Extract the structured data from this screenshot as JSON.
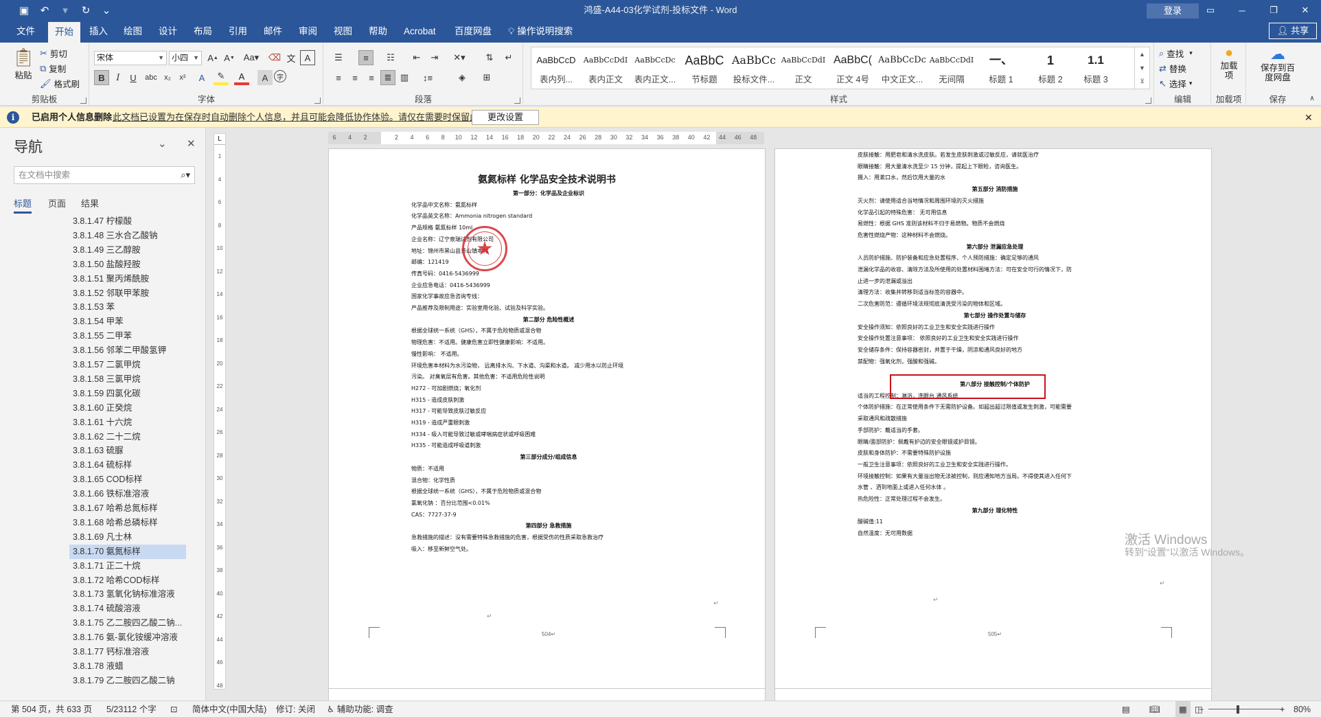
{
  "titlebar": {
    "title": "鸿盛-A44-03化学试剂-投标文件  -  Word",
    "login": "登录",
    "save_icon": "save-icon",
    "undo_icon": "undo-icon",
    "redo_icon": "redo-icon",
    "customize_icon": "customize-icon"
  },
  "menu": {
    "items": [
      "文件",
      "开始",
      "插入",
      "绘图",
      "设计",
      "布局",
      "引用",
      "邮件",
      "审阅",
      "视图",
      "帮助",
      "Acrobat",
      "百度网盘"
    ],
    "active": "开始",
    "tell_me": "操作说明搜索",
    "share": "共享"
  },
  "ribbon": {
    "clipboard": {
      "paste": "粘贴",
      "cut": "剪切",
      "copy": "复制",
      "format_painter": "格式刷",
      "label": "剪贴板"
    },
    "font": {
      "name": "宋体",
      "size": "小四",
      "label": "字体"
    },
    "paragraph": {
      "label": "段落"
    },
    "styles": {
      "label": "样式",
      "items": [
        {
          "preview": "AaBbCcD",
          "name": "表内列..."
        },
        {
          "preview": "AaBbCcDdI",
          "name": "表内正文"
        },
        {
          "preview": "AaBbCcDc",
          "name": "表内正文..."
        },
        {
          "preview": "AaBbC",
          "name": "节标题"
        },
        {
          "preview": "AaBbCc",
          "name": "投标文件..."
        },
        {
          "preview": "AaBbCcDdI",
          "name": "正文"
        },
        {
          "preview": "AaBbC(",
          "name": "正文 4号"
        },
        {
          "preview": "AaBbCcDc",
          "name": "中文正文..."
        },
        {
          "preview": "AaBbCcDdI",
          "name": "无间隔"
        },
        {
          "preview": "一、",
          "name": "标题 1"
        },
        {
          "preview": "1",
          "name": "标题 2"
        },
        {
          "preview": "1.1",
          "name": "标题 3"
        }
      ]
    },
    "editing": {
      "find": "查找",
      "replace": "替换",
      "select": "选择",
      "label": "编辑"
    },
    "addins": {
      "btn": "加载项",
      "label": "加载项"
    },
    "save": {
      "btn": "保存到百度网盘",
      "label": "保存"
    }
  },
  "notification": {
    "title": "已启用个人信息删除",
    "message": "此文档已设置为在保存时自动删除个人信息，并且可能会降低协作体验。请仅在需要时保留此设置。",
    "button": "更改设置"
  },
  "nav": {
    "title": "导航",
    "search_placeholder": "在文档中搜索",
    "tabs": [
      "标题",
      "页面",
      "结果"
    ],
    "items": [
      "3.8.1.47 柠檬酸",
      "3.8.1.48 三水合乙酸钠",
      "3.8.1.49 三乙醇胺",
      "3.8.1.50 盐酸羟胺",
      "3.8.1.51 聚丙烯酰胺",
      "3.8.1.52 邻联甲苯胺",
      "3.8.1.53 苯",
      "3.8.1.54 甲苯",
      "3.8.1.55 二甲苯",
      "3.8.1.56 邻苯二甲酸氢钾",
      "3.8.1.57 二氯甲烷",
      "3.8.1.58 三氯甲烷",
      "3.8.1.59 四氯化碳",
      "3.8.1.60 正癸烷",
      "3.8.1.61 十六烷",
      "3.8.1.62 二十二烷",
      "3.8.1.63 硫脲",
      "3.8.1.64 硫标样",
      "3.8.1.65 COD标样",
      "3.8.1.66 铁标准溶液",
      "3.8.1.67 哈希总氮标样",
      "3.8.1.68 哈希总磷标样",
      "3.8.1.69 凡士林",
      "3.8.1.70 氨氮标样",
      "3.8.1.71 正二十烷",
      "3.8.1.72 哈希COD标样",
      "3.8.1.73 氢氧化钠标准溶液",
      "3.8.1.74 硫酸溶液",
      "3.8.1.75 乙二胺四乙酸二钠...",
      "3.8.1.76 氨-氯化铵缓冲溶液",
      "3.8.1.77 钙标准溶液",
      "3.8.1.78 液蜡",
      "3.8.1.79 乙二胺四乙酸二钠"
    ],
    "selected": "3.8.1.70 氨氮标样"
  },
  "ruler": {
    "h_ticks": [
      "6",
      "4",
      "2",
      "",
      "2",
      "4",
      "6",
      "8",
      "10",
      "12",
      "14",
      "16",
      "18",
      "20",
      "22",
      "24",
      "26",
      "28",
      "30",
      "32",
      "34",
      "36",
      "38",
      "40",
      "42",
      "44",
      "46",
      "48"
    ],
    "v_ticks": [
      "1",
      "4",
      "6",
      "8",
      "10",
      "12",
      "14",
      "16",
      "18",
      "20",
      "22",
      "24",
      "26",
      "28",
      "30",
      "32",
      "34",
      "36",
      "38",
      "40",
      "42",
      "44",
      "46",
      "48"
    ]
  },
  "page1": {
    "title": "氨氮标样 化学品安全技术说明书",
    "lines": [
      {
        "t": "第一部分：化学品及企业标识",
        "c": 1
      },
      {
        "t": "化学品中文名称：氨氮标样"
      },
      {
        "t": "化学品英文名称：Ammonia nitrogen standard"
      },
      {
        "t": "产品规格  氨氮标样 10ml"
      },
      {
        "t": "企业名称：辽宁泉瑞试剂有限公司"
      },
      {
        "t": "地址：锦州市黑山县芳山镇本村"
      },
      {
        "t": "邮编：121419"
      },
      {
        "t": "传真号码：0416-5436999"
      },
      {
        "t": "企业应急电话：0416-5436999"
      },
      {
        "t": "国家化学事故应急咨询专线："
      },
      {
        "t": "产品推荐及限制用途：实验室用化验、试验及科学实验。"
      },
      {
        "t": "第二部分 危险性概述",
        "c": 1
      },
      {
        "t": "根据全球统一系统（GHS），不属于危险物质或混合物"
      },
      {
        "t": "物理危害：不适用。健康危害立即性健康影响：不适用。"
      },
      {
        "t": "慢性影响：  不适用。"
      },
      {
        "t": "环境危害本材料为水污染物，  远离排水沟、下水道、沟渠和水道。 减少用水以防止环境"
      },
      {
        "t": "污染。  对臭氧层有危害。其他危害：不适用危险性说明"
      },
      {
        "t": "H272 - 可加剧燃烧；氧化剂"
      },
      {
        "t": "H315 - 造成皮肤刺激"
      },
      {
        "t": "H317 - 可能导致皮肤过敏反应"
      },
      {
        "t": "H319 - 造成严重眼刺激"
      },
      {
        "t": "H334 - 吸入可能导致过敏或哮喘病症状或呼吸困难"
      },
      {
        "t": "H335 - 可能造成呼吸道刺激"
      },
      {
        "t": "第三部分成分/组成信息",
        "c": 1
      },
      {
        "t": "物质：不适用"
      },
      {
        "t": "混合物：化学性质"
      },
      {
        "t": "根据全球统一系统（GHS），不属于危险物质或混合物"
      },
      {
        "t": "氯氧化钠    ：百分比范围<0.01%"
      },
      {
        "t": "CAS：7727-37-9"
      },
      {
        "t": "第四部分 急救措施",
        "c": 1
      },
      {
        "t": "急救措施的描述：没有需要特殊急救措施的危害，根据受伤的性质采取急救治疗"
      },
      {
        "t": "吸入：移至新鲜空气处。"
      }
    ],
    "page_number": "504↵"
  },
  "page2": {
    "lines": [
      {
        "t": "皮肤接触：用肥皂和清水洗皮肤。若发生皮肤刺激或过敏反应，请就医治疗"
      },
      {
        "t": "眼睛接触：用大量清水洗至少 15 分钟，提起上下眼睑，咨询医生。"
      },
      {
        "t": "摄入：用漱口水，然后饮用大量的水"
      },
      {
        "t": "第五部分 消防措施",
        "c": 1
      },
      {
        "t": "灭火剂：请使用适合当地情况和周围环境的灭火措施"
      },
      {
        "t": "化学品引起的特殊危害：   无可用信息"
      },
      {
        "t": "易燃性：根据 GHS 准则该材料不归于易燃物。物质不会燃烧"
      },
      {
        "t": "危害性燃烧产物：这种材料不会燃烧。"
      },
      {
        "t": "第六部分 泄漏应急处理",
        "c": 1
      },
      {
        "t": "人员防护措施、防护装备和应急处置程序、个人预防措施：确定足够的通风"
      },
      {
        "t": "泄漏化学品的收容、清除方法及所使用的处置材料围堵方法：可在安全可行的情况下，防"
      },
      {
        "t": "止进一步的泄漏或溢出"
      },
      {
        "t": "清理方法：收集并转移到适当标签的容器中。"
      },
      {
        "t": "二次危害防范：遵循环境法规彻底清洗受污染的物体和区域。"
      },
      {
        "t": "第七部分 操作处置与储存",
        "c": 1
      },
      {
        "t": "安全操作须知：依照良好的工业卫生和安全实践进行操作"
      },
      {
        "t": "安全操作处置注意事项：  依照良好的工业卫生和安全实践进行操作"
      },
      {
        "t": "安全储存条件：保持容器密封，并置于干燥，阴凉和通风良好的地方"
      },
      {
        "t": "禁配物：强氧化剂，强酸和强碱。"
      },
      {
        "t": "",
        "c": 1
      },
      {
        "t": "第八部分 接触控制/个体防护",
        "c": 1
      },
      {
        "t": "适当的工程控制：淋浴，洗眼台 通风系统"
      },
      {
        "t": "个体防护措施：在正常使用条件下无需防护设备。如超出超过限值或发生刺激，可能需要"
      },
      {
        "t": "采取通风和疏散措施"
      },
      {
        "t": "手部防护：戴适当的手套。"
      },
      {
        "t": "眼睛/面部防护：佩戴有护边的安全眼镜或护目镜。"
      },
      {
        "t": "皮肤和身体防护：不需要特殊防护设施"
      },
      {
        "t": "一般卫生注意事项：依照良好的工业卫生和安全实践进行操作。"
      },
      {
        "t": "环境接触控制：如果有大量溢出物无法被控制，则应通知地方当局。不得使其进入任何下"
      },
      {
        "t": "水管 、洒到地面上或进入任何水体 。"
      },
      {
        "t": "热危险性：正常处理过程不会发生。"
      },
      {
        "t": "第九部分 理化特性",
        "c": 1
      },
      {
        "t": "酸碱值:11"
      },
      {
        "t": "自然温度：无可用数据"
      }
    ],
    "page_number": "505↵"
  },
  "watermark": {
    "line1": "激活 Windows",
    "line2": "转到“设置”以激活 Windows。"
  },
  "status": {
    "page": "第 504 页，共 633 页",
    "words": "5/23112 个字",
    "language": "简体中文(中国大陆)",
    "track": "修订: 关闭",
    "accessibility": "辅助功能: 调查",
    "zoom": "80%"
  }
}
